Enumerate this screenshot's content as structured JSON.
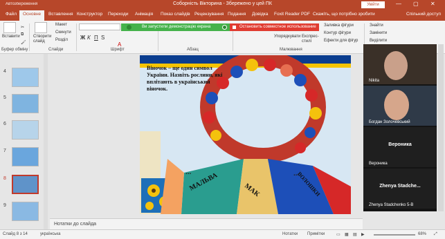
{
  "titlebar": {
    "quick_access": "Автозбереження",
    "title": "Соборність Вікторина - Збережено у цей ПК",
    "login": "Увійти"
  },
  "tabs": [
    "Файл",
    "Основне",
    "Вставлення",
    "Конструктор",
    "Переходи",
    "Анімація",
    "Показ слайдів",
    "Рецензування",
    "Подання",
    "Довідка",
    "Foxit Reader PDF",
    "Скажіть, що потрібно зробити"
  ],
  "active_tab_index": 1,
  "share_label": "Спільний доступ",
  "ribbon": {
    "paste": "Вставити",
    "clipboard_group": "Буфер обміну",
    "new_slide": "Створити слайд",
    "layout": "Макет",
    "reset": "Скинути",
    "section": "Розділ",
    "slides_group": "Слайди",
    "font_group": "Шрифт",
    "paragraph_group": "Абзац",
    "arrange": "Упорядкувати",
    "quick_styles": "Експрес-стилі",
    "shape_fill": "Заливка фігури",
    "shape_outline": "Контур фігури",
    "shape_effects": "Ефекти для фігур",
    "drawing_group": "Малювання",
    "find": "Знайти",
    "replace": "Замінити",
    "select": "Виділити"
  },
  "notifications": {
    "green": "Ви запустили демонстрацію екрана",
    "red": "Остановить совместное использование"
  },
  "thumbnails": [
    "4",
    "5",
    "6",
    "7",
    "8",
    "9"
  ],
  "selected_thumbnail": "8",
  "slide": {
    "question": "Віночок – ще один символ України. Назвіть рослини, які вплітають в український віночок.",
    "ribbon_text_1": "МАЛЬВА",
    "ribbon_text_2": "МАК",
    "ribbon_text_3": "ВОЛОШКИ",
    "dots": "..."
  },
  "notes_placeholder": "Нотатки до слайда",
  "status": {
    "slide_counter": "Слайд 8 з 14",
    "language": "українська",
    "notes": "Нотатки",
    "comments": "Примітки",
    "zoom": "68%"
  },
  "participants": [
    {
      "name": "Nikita"
    },
    {
      "name": "Богдан Золочевський"
    },
    {
      "name": "Вероника",
      "label": "Вероника"
    },
    {
      "name": "Zhenya Stadchenko 5-В",
      "label": "Zhenya Stadche..."
    }
  ],
  "colors": {
    "accent": "#b7472a",
    "green": "#45b24b",
    "red": "#e03c31"
  }
}
